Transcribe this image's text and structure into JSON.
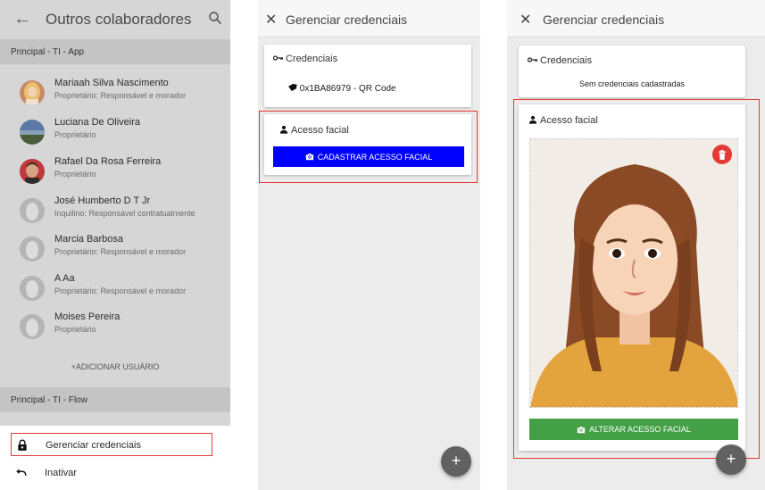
{
  "panel1": {
    "title": "Outros colaboradores",
    "section1": "Principal - TI - App",
    "users": [
      {
        "name": "Mariaah Silva Nascimento",
        "role": "Proprietário: Responsável e morador",
        "avatar": "photo-woman-blonde"
      },
      {
        "name": "Luciana De Oliveira",
        "role": "Proprietário",
        "avatar": "photo-landscape"
      },
      {
        "name": "Rafael Da Rosa Ferreira",
        "role": "Proprietário",
        "avatar": "photo-man"
      },
      {
        "name": "José Humberto D T Jr",
        "role": "Inquilino: Responsável contratualmente",
        "avatar": "default-person"
      },
      {
        "name": "Marcia Barbosa",
        "role": "Proprietário: Responsável e morador",
        "avatar": "default-person"
      },
      {
        "name": "A Aa",
        "role": "Proprietário: Responsável e morador",
        "avatar": "default-person"
      },
      {
        "name": "Moises Pereira",
        "role": "Proprietário",
        "avatar": "default-person"
      }
    ],
    "add_user": "+ADICIONAR USUÁRIO",
    "section2": "Principal - TI - Flow",
    "menu": {
      "manage_credentials": "Gerenciar credenciais",
      "deactivate": "Inativar"
    }
  },
  "panel2": {
    "title": "Gerenciar credenciais",
    "credentials_title": "Credenciais",
    "credential_item": "0x1BA86979 - QR Code",
    "facial_title": "Acesso facial",
    "register_button": "CADASTRAR ACESSO FACIAL",
    "fab": "+"
  },
  "panel3": {
    "title": "Gerenciar credenciais",
    "credentials_title": "Credenciais",
    "no_credentials": "Sem credenciais cadastradas",
    "facial_title": "Acesso facial",
    "change_button": "ALTERAR ACESSO FACIAL",
    "fab": "+"
  },
  "colors": {
    "register_blue": "#0000ff",
    "change_green": "#43a047",
    "delete_red": "#e53935",
    "highlight_red": "#e53935"
  }
}
